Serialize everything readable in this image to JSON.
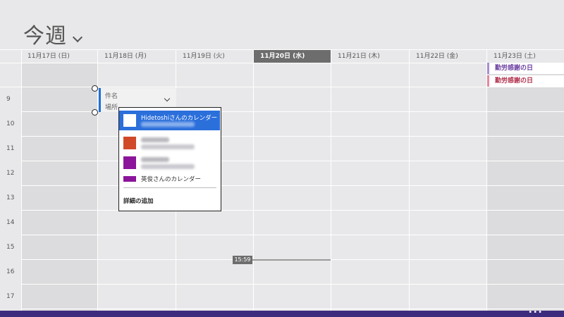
{
  "header": {
    "title": "今週"
  },
  "days": [
    {
      "label": "11月17日 (日)"
    },
    {
      "label": "11月18日 (月)"
    },
    {
      "label": "11月19日 (火)"
    },
    {
      "label": "11月20日 (水)"
    },
    {
      "label": "11月21日 (木)"
    },
    {
      "label": "11月22日 (金)"
    },
    {
      "label": "11月23日 (土)"
    }
  ],
  "hours": [
    "9",
    "10",
    "11",
    "12",
    "13",
    "14",
    "15",
    "16",
    "17"
  ],
  "holidays": [
    {
      "label": "勤労感謝の日"
    },
    {
      "label": "勤労感謝の日"
    }
  ],
  "event_editor": {
    "subject_placeholder": "件名",
    "location_placeholder": "場所"
  },
  "calendar_picker": {
    "items": [
      {
        "name": "Hidetoshiさんのカレンダー",
        "color": "#ffffff",
        "selected": true
      },
      {
        "name": "",
        "color": "#d04a2a"
      },
      {
        "name": "",
        "color": "#8b159a"
      },
      {
        "name": "英俊さんのカレンダー",
        "color": "#8b159a"
      }
    ],
    "more_label": "詳細の追加"
  },
  "current_time": "15:59",
  "colors": {
    "accent_bar": "#3d2b7e",
    "selection": "#2b6fdb",
    "today_header": "#6d6d6d"
  }
}
